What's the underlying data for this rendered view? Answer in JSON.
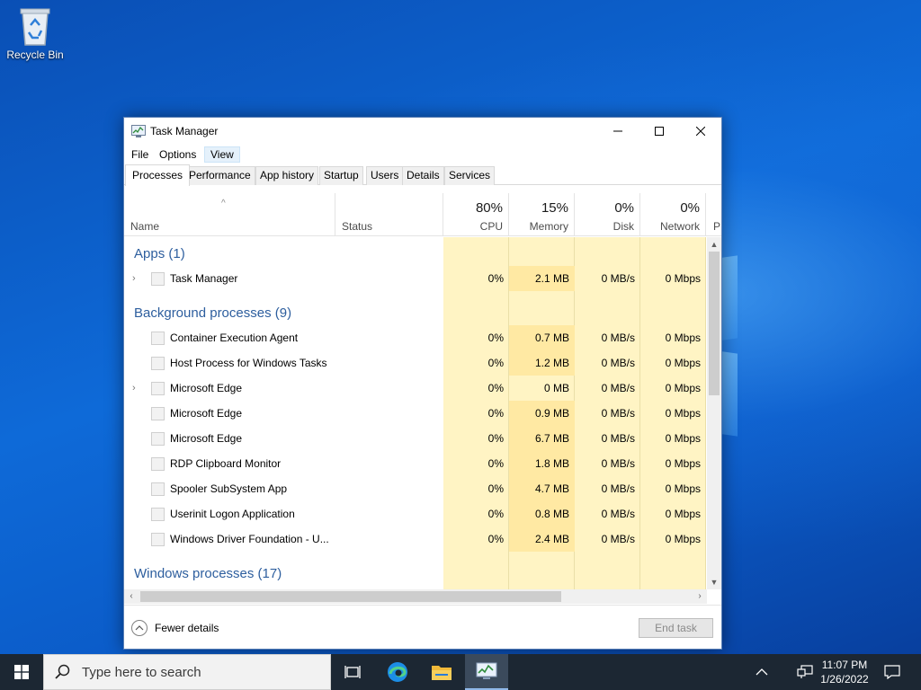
{
  "desktop": {
    "icons": [
      {
        "label": "Recycle Bin",
        "icon": "recycle-bin-icon"
      }
    ]
  },
  "window": {
    "title": "Task Manager",
    "menu": [
      "File",
      "Options",
      "View"
    ],
    "tabs": [
      "Processes",
      "Performance",
      "App history",
      "Startup",
      "Users",
      "Details",
      "Services"
    ],
    "active_tab": "Processes",
    "columns": {
      "name": "Name",
      "status": "Status",
      "cpu": {
        "pct": "80%",
        "label": "CPU"
      },
      "memory": {
        "pct": "15%",
        "label": "Memory"
      },
      "disk": {
        "pct": "0%",
        "label": "Disk"
      },
      "network": {
        "pct": "0%",
        "label": "Network"
      },
      "power_partial": "P"
    },
    "groups": {
      "apps": "Apps (1)",
      "background": "Background processes (9)",
      "windows": "Windows processes (17)"
    },
    "rows": [
      {
        "name": "Task Manager",
        "cpu": "0%",
        "mem": "2.1 MB",
        "disk": "0 MB/s",
        "net": "0 Mbps"
      },
      {
        "name": "Container Execution Agent",
        "cpu": "0%",
        "mem": "0.7 MB",
        "disk": "0 MB/s",
        "net": "0 Mbps"
      },
      {
        "name": "Host Process for Windows Tasks",
        "cpu": "0%",
        "mem": "1.2 MB",
        "disk": "0 MB/s",
        "net": "0 Mbps"
      },
      {
        "name": "Microsoft Edge",
        "cpu": "0%",
        "mem": "0 MB",
        "disk": "0 MB/s",
        "net": "0 Mbps"
      },
      {
        "name": "Microsoft Edge",
        "cpu": "0%",
        "mem": "0.9 MB",
        "disk": "0 MB/s",
        "net": "0 Mbps"
      },
      {
        "name": "Microsoft Edge",
        "cpu": "0%",
        "mem": "6.7 MB",
        "disk": "0 MB/s",
        "net": "0 Mbps"
      },
      {
        "name": "RDP Clipboard Monitor",
        "cpu": "0%",
        "mem": "1.8 MB",
        "disk": "0 MB/s",
        "net": "0 Mbps"
      },
      {
        "name": "Spooler SubSystem App",
        "cpu": "0%",
        "mem": "4.7 MB",
        "disk": "0 MB/s",
        "net": "0 Mbps"
      },
      {
        "name": "Userinit Logon Application",
        "cpu": "0%",
        "mem": "0.8 MB",
        "disk": "0 MB/s",
        "net": "0 Mbps"
      },
      {
        "name": "Windows Driver Foundation - U...",
        "cpu": "0%",
        "mem": "2.4 MB",
        "disk": "0 MB/s",
        "net": "0 Mbps"
      }
    ],
    "footer": {
      "fewer_details": "Fewer details",
      "end_task": "End task"
    }
  },
  "taskbar": {
    "search_placeholder": "Type here to search",
    "time": "11:07 PM",
    "date": "1/26/2022"
  },
  "colors": {
    "accent": "#2d5e9e",
    "heat_light": "#fff4c4",
    "heat_dark": "#ffe9a3",
    "taskbar": "#1c2733"
  }
}
